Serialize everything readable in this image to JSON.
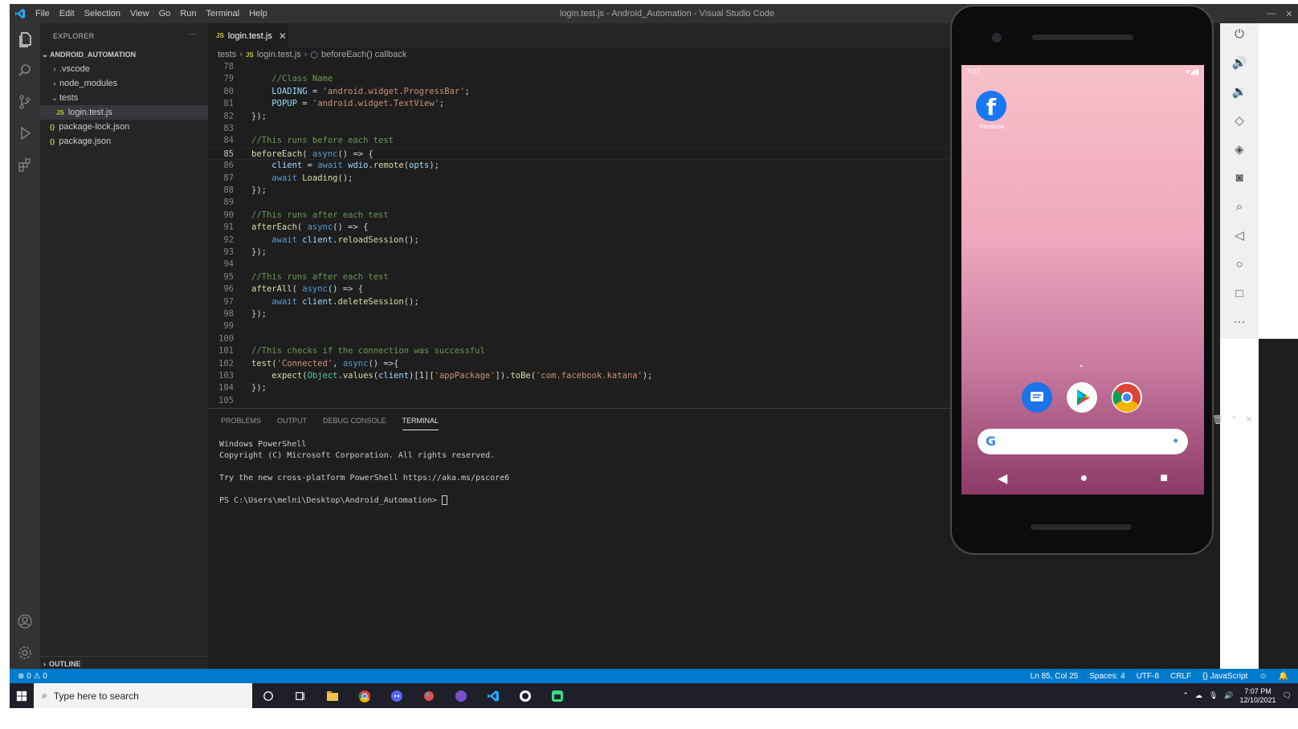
{
  "titlebar": {
    "menus": [
      "File",
      "Edit",
      "Selection",
      "View",
      "Go",
      "Run",
      "Terminal",
      "Help"
    ],
    "window_title": "login.test.js - Android_Automation - Visual Studio Code"
  },
  "activity_bar": {
    "icons": [
      "explorer-icon",
      "search-icon",
      "source-control-icon",
      "run-debug-icon",
      "extensions-icon",
      "accounts-icon",
      "manage-gear-icon"
    ]
  },
  "sidebar": {
    "header": "EXPLORER",
    "more": "···",
    "root": "ANDROID_AUTOMATION",
    "items": [
      {
        "label": ".vscode",
        "kind": "folder",
        "expanded": false
      },
      {
        "label": "node_modules",
        "kind": "folder",
        "expanded": false
      },
      {
        "label": "tests",
        "kind": "folder",
        "expanded": true
      },
      {
        "label": "login.test.js",
        "kind": "js",
        "selected": true
      },
      {
        "label": "package-lock.json",
        "kind": "json"
      },
      {
        "label": "package.json",
        "kind": "json"
      }
    ],
    "outline": "OUTLINE"
  },
  "editor": {
    "tab_label": "login.test.js",
    "tab_icon": "JS",
    "breadcrumb": [
      "tests",
      "login.test.js",
      "beforeEach() callback"
    ],
    "active_line": 85,
    "lines": [
      {
        "n": "78",
        "text": ""
      },
      {
        "n": "79",
        "text": "    //Class Name"
      },
      {
        "n": "80",
        "text": "    LOADING = 'android.widget.ProgressBar';"
      },
      {
        "n": "81",
        "text": "    POPUP = 'android.widget.TextView';"
      },
      {
        "n": "82",
        "text": "});"
      },
      {
        "n": "83",
        "text": ""
      },
      {
        "n": "84",
        "text": "//This runs before each test"
      },
      {
        "n": "85",
        "text": "beforeEach( async() => {"
      },
      {
        "n": "86",
        "text": "    client = await wdio.remote(opts);"
      },
      {
        "n": "87",
        "text": "    await Loading();"
      },
      {
        "n": "88",
        "text": "});"
      },
      {
        "n": "89",
        "text": ""
      },
      {
        "n": "90",
        "text": "//This runs after each test"
      },
      {
        "n": "91",
        "text": "afterEach( async() => {"
      },
      {
        "n": "92",
        "text": "    await client.reloadSession();"
      },
      {
        "n": "93",
        "text": "});"
      },
      {
        "n": "94",
        "text": ""
      },
      {
        "n": "95",
        "text": "//This runs after each test"
      },
      {
        "n": "96",
        "text": "afterAll( async() => {"
      },
      {
        "n": "97",
        "text": "    await client.deleteSession();"
      },
      {
        "n": "98",
        "text": "});"
      },
      {
        "n": "99",
        "text": ""
      },
      {
        "n": "100",
        "text": ""
      },
      {
        "n": "101",
        "text": "//This checks if the connection was successful"
      },
      {
        "n": "102",
        "text": "test('Connected', async() =>{"
      },
      {
        "n": "103",
        "text": "    expect(Object.values(client)[1]['appPackage']).toBe('com.facebook.katana');"
      },
      {
        "n": "104",
        "text": "});"
      },
      {
        "n": "105",
        "text": ""
      }
    ]
  },
  "panel": {
    "tabs": [
      "PROBLEMS",
      "OUTPUT",
      "DEBUG CONSOLE",
      "TERMINAL"
    ],
    "active_tab": "TERMINAL",
    "terminal_lines": [
      "Windows PowerShell",
      "Copyright (C) Microsoft Corporation. All rights reserved.",
      "",
      "Try the new cross-platform PowerShell https://aka.ms/pscore6",
      "",
      "PS C:\\Users\\melni\\Desktop\\Android_Automation> "
    ]
  },
  "phone": {
    "time": "7:07",
    "app_label": "Facebook",
    "dock_icons": [
      "messages-icon",
      "play-store-icon",
      "chrome-icon"
    ],
    "search_logo": "G"
  },
  "emulator_toolbar": {
    "icons": [
      "power-icon",
      "volume-up-icon",
      "volume-down-icon",
      "rotate-left-icon",
      "rotate-right-icon",
      "camera-icon",
      "zoom-icon",
      "back-icon",
      "home-icon",
      "overview-icon",
      "more-icon"
    ]
  },
  "statusbar": {
    "errors": "0",
    "warnings": "0",
    "position": "Ln 85, Col 25",
    "spaces": "Spaces: 4",
    "encoding": "UTF-8",
    "eol": "CRLF",
    "language": "JavaScript"
  },
  "taskbar": {
    "search_placeholder": "Type here to search",
    "apps": [
      "cortana-icon",
      "task-view-icon",
      "file-explorer-icon",
      "chrome-icon",
      "discord-icon",
      "paint-icon",
      "app-icon",
      "vscode-icon",
      "app2-icon",
      "android-studio-icon"
    ],
    "time": "7:07 PM",
    "date": "12/10/2021"
  },
  "colors": {
    "accent": "#007acc",
    "editor_bg": "#1e1e1e",
    "sidebar_bg": "#252526",
    "activity_bg": "#333333"
  }
}
